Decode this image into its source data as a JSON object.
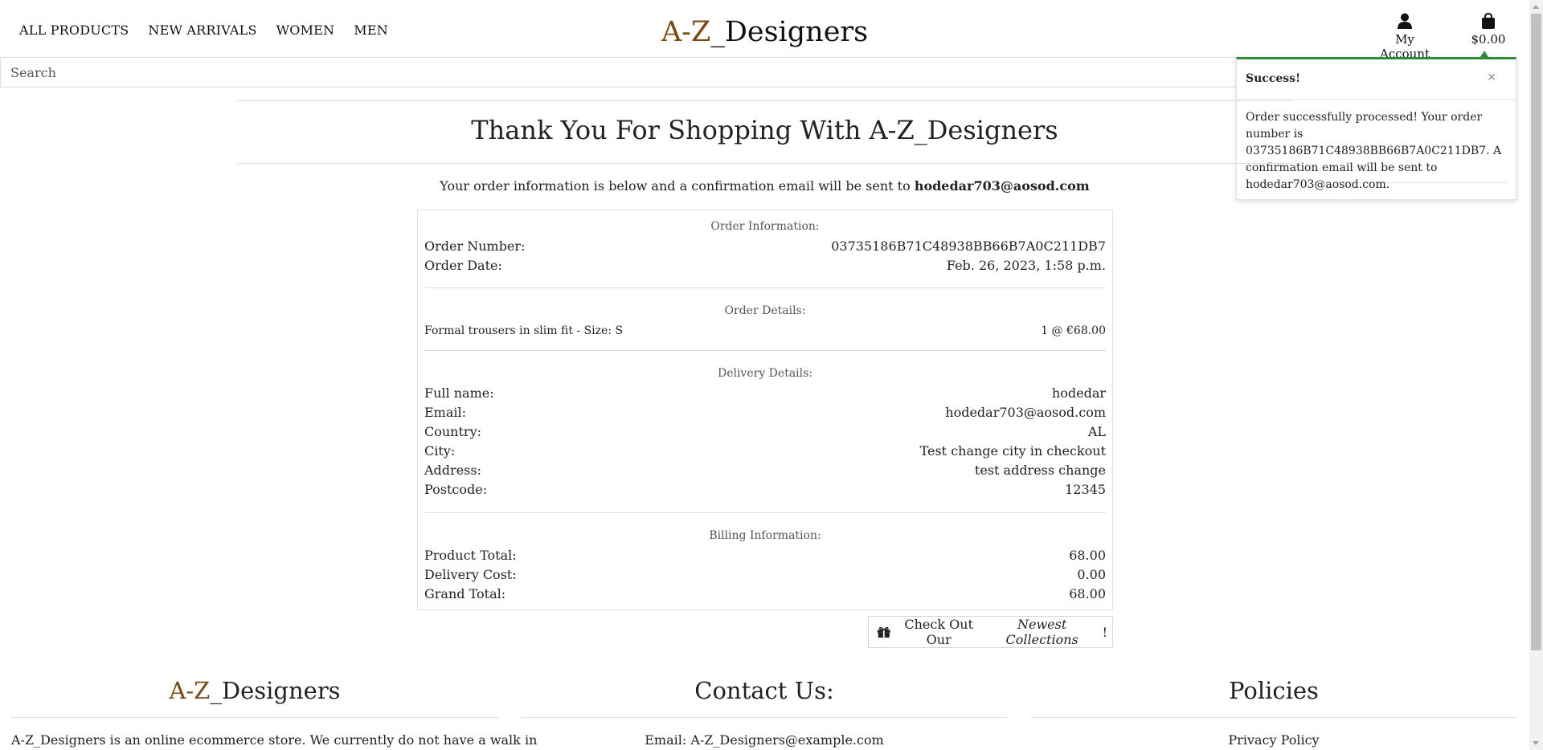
{
  "nav": {
    "items": [
      "ALL PRODUCTS",
      "NEW ARRIVALS",
      "WOMEN",
      "MEN"
    ]
  },
  "brand": {
    "part1": "A-Z",
    "part2": "_Designers"
  },
  "account": {
    "label": "My Account",
    "icon": "user-icon"
  },
  "cart": {
    "total": "$0.00",
    "icon": "shopping-bag-icon"
  },
  "search": {
    "placeholder": "Search"
  },
  "toast": {
    "title": "Success!",
    "close": "×",
    "message": "Order successfully processed! Your order number is 03735186B71C48938BB66B7A0C211DB7. A confirmation email will be sent to hodedar703@aosod.com.",
    "accent": "#2e8b3a"
  },
  "main": {
    "title": "Thank You For Shopping With A-Z_Designers",
    "intro_prefix": "Your order information is below and a confirmation email will be sent to ",
    "intro_email": "hodedar703@aosod.com"
  },
  "order": {
    "info_title": "Order Information:",
    "info": [
      {
        "label": "Order Number:",
        "value": "03735186B71C48938BB66B7A0C211DB7"
      },
      {
        "label": "Order Date:",
        "value": "Feb. 26, 2023, 1:58 p.m."
      }
    ],
    "details_title": "Order Details:",
    "items": [
      {
        "label": "Formal trousers in slim fit - Size: S",
        "value": "1 @ €68.00"
      }
    ],
    "delivery_title": "Delivery Details:",
    "delivery": [
      {
        "label": "Full name:",
        "value": "hodedar"
      },
      {
        "label": "Email:",
        "value": "hodedar703@aosod.com"
      },
      {
        "label": "Country:",
        "value": "AL"
      },
      {
        "label": "City:",
        "value": "Test change city in checkout"
      },
      {
        "label": "Address:",
        "value": "test address change"
      },
      {
        "label": "Postcode:",
        "value": "12345"
      }
    ],
    "billing_title": "Billing Information:",
    "billing": [
      {
        "label": "Product Total:",
        "value": "68.00"
      },
      {
        "label": "Delivery Cost:",
        "value": "0.00"
      },
      {
        "label": "Grand Total:",
        "value": "68.00"
      }
    ]
  },
  "collections_button": {
    "prefix": "Check Out Our ",
    "emphasis": "Newest Collections",
    "suffix": "!",
    "icon": "gift-icon"
  },
  "footer": {
    "brand_part1": "A-Z",
    "brand_part2": "_Designers",
    "about": "A-Z_Designers is an online ecommerce store. We currently do not have a walk in",
    "contact_title": "Contact Us:",
    "contact_email": "Email: A-Z_Designers@example.com",
    "policies_title": "Policies",
    "privacy": "Privacy Policy"
  },
  "colors": {
    "brand_accent": "#7a4a12",
    "success": "#2e8b3a"
  }
}
